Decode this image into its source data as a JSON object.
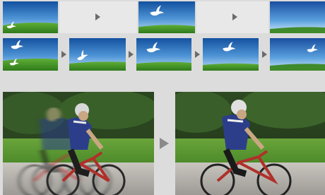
{
  "colors": {
    "background": "#dcdcdc",
    "panel": "#e8e8e8",
    "sky_top": "#1b5fb0",
    "sky_bottom": "#a9d4f0",
    "grass": "#4f9a2c",
    "arrow": "#6b6b6b"
  },
  "top_row": {
    "frames": [
      {
        "icon": "dove-landscape-icon",
        "subject": "bird-low-left"
      },
      {
        "icon": "placeholder-panel",
        "subject": "empty"
      },
      {
        "icon": "dove-landscape-icon",
        "subject": "bird-center"
      },
      {
        "icon": "placeholder-panel",
        "subject": "empty"
      },
      {
        "icon": "sky-landscape-icon",
        "subject": "sky-only"
      }
    ],
    "arrows": [
      "play-arrow-icon",
      "play-arrow-icon"
    ]
  },
  "middle_row": {
    "frames": [
      {
        "icon": "dove-landscape-icon",
        "subject": "two-birds"
      },
      {
        "icon": "dove-landscape-icon",
        "subject": "bird-wings-up"
      },
      {
        "icon": "dove-landscape-icon",
        "subject": "bird-center"
      },
      {
        "icon": "dove-landscape-icon",
        "subject": "bird-upper-center"
      },
      {
        "icon": "dove-landscape-icon",
        "subject": "bird-right"
      }
    ],
    "arrows": [
      "play-arrow-icon",
      "play-arrow-icon",
      "play-arrow-icon",
      "play-arrow-icon"
    ]
  },
  "bottom_row": {
    "before": {
      "icon": "cyclist-blurred-photo",
      "state": "motion-blur"
    },
    "after": {
      "icon": "cyclist-sharp-photo",
      "state": "sharp"
    },
    "arrow": "play-arrow-icon"
  }
}
